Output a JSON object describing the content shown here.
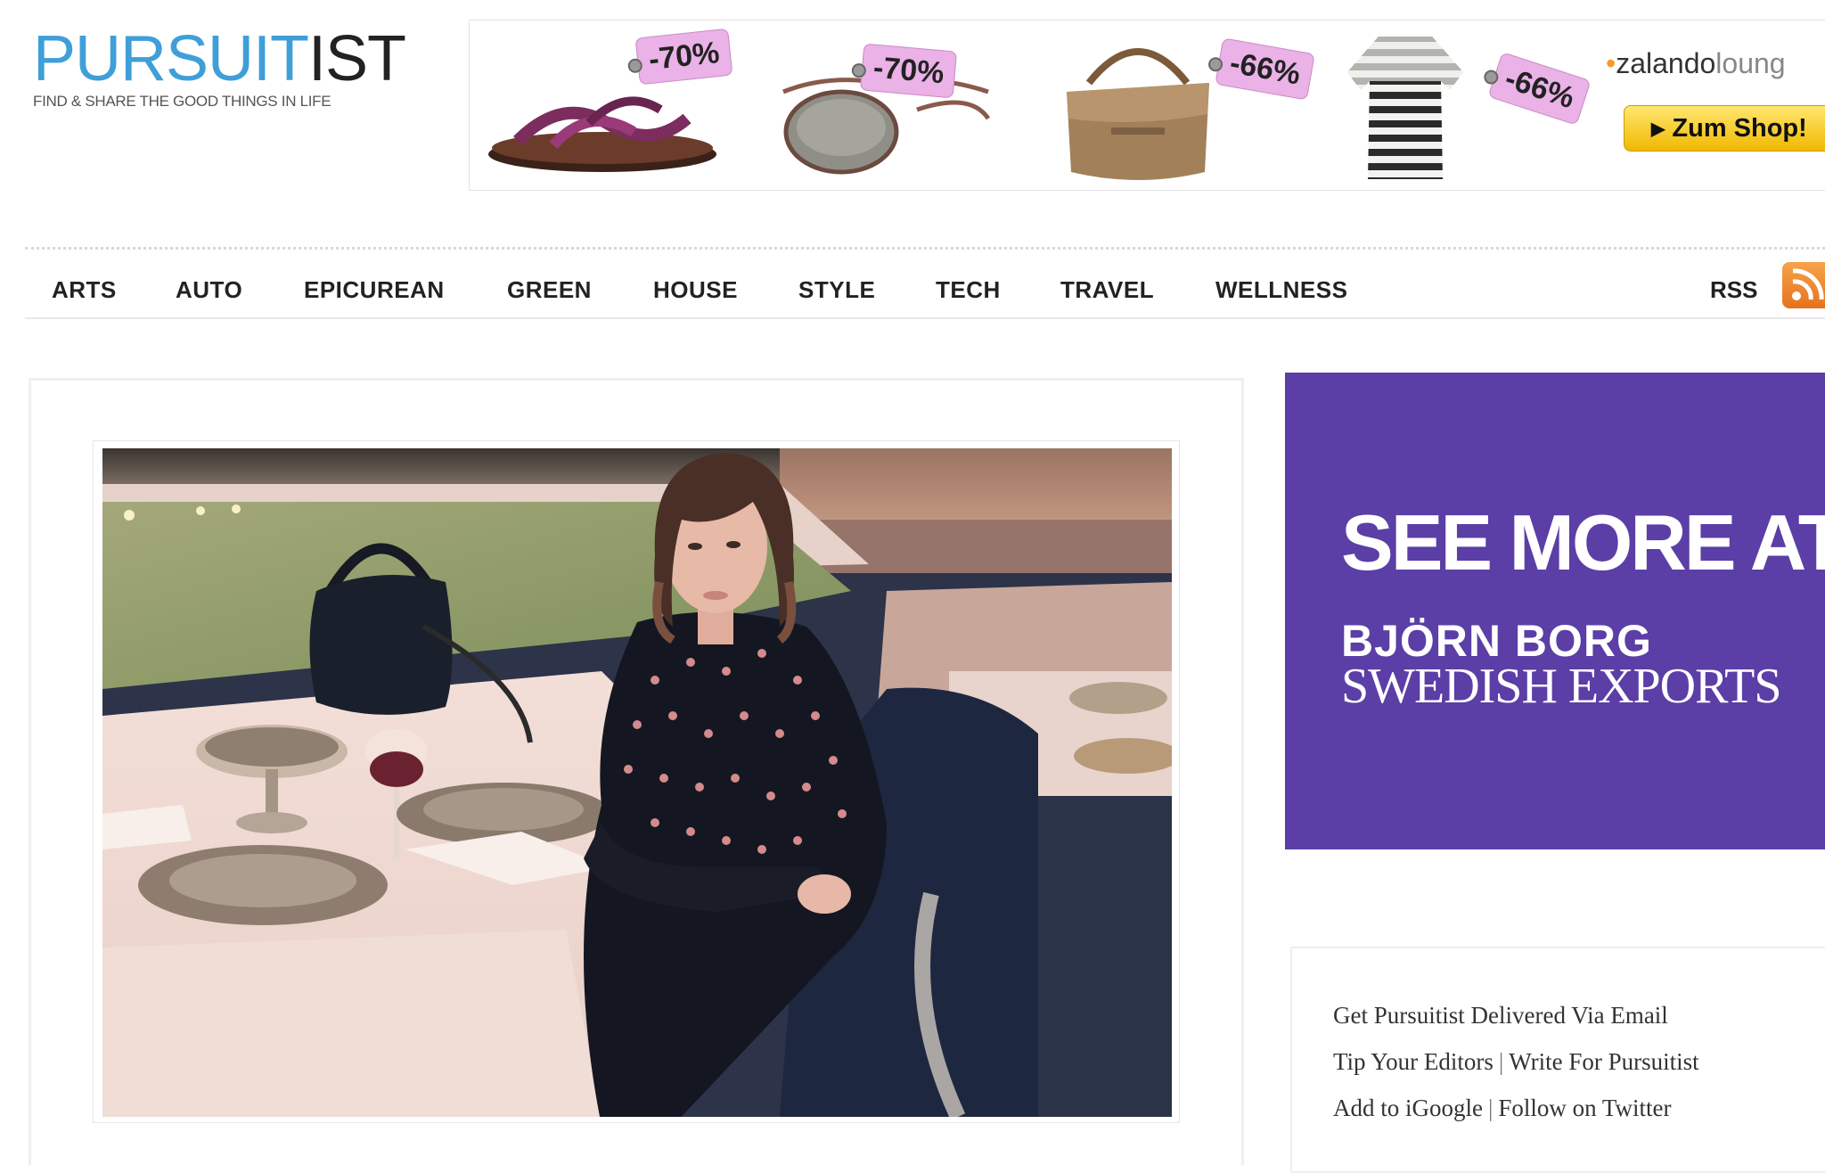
{
  "logo": {
    "part1": "PURSUIT",
    "part2": "IST",
    "tagline": "FIND & SHARE THE GOOD THINGS IN LIFE"
  },
  "banner": {
    "discounts": [
      "-70%",
      "-70%",
      "-66%",
      "-66%"
    ],
    "brand_prefix": "zalando",
    "brand_suffix": "loung",
    "cta": "Zum Shop!"
  },
  "nav": {
    "items": [
      "ARTS",
      "AUTO",
      "EPICUREAN",
      "GREEN",
      "HOUSE",
      "STYLE",
      "TECH",
      "TRAVEL",
      "WELLNESS"
    ],
    "rss": "RSS"
  },
  "side_ad": {
    "line1": "SEE MORE AT",
    "line2": "BJÖRN BORG",
    "line3": "SWEDISH EXPORTS"
  },
  "links": {
    "email": "Get Pursuitist Delivered Via Email",
    "tip": "Tip Your Editors",
    "write": "Write For Pursuitist",
    "igoogle": "Add to iGoogle",
    "twitter": "Follow on Twitter",
    "separator": "|"
  },
  "colors": {
    "logo_blue": "#3f9fd8",
    "tag_pink": "#eab2e6",
    "button_yellow": "#f7c600",
    "ad_purple": "#5b3ea6",
    "rss_orange": "#ee8a2f"
  }
}
